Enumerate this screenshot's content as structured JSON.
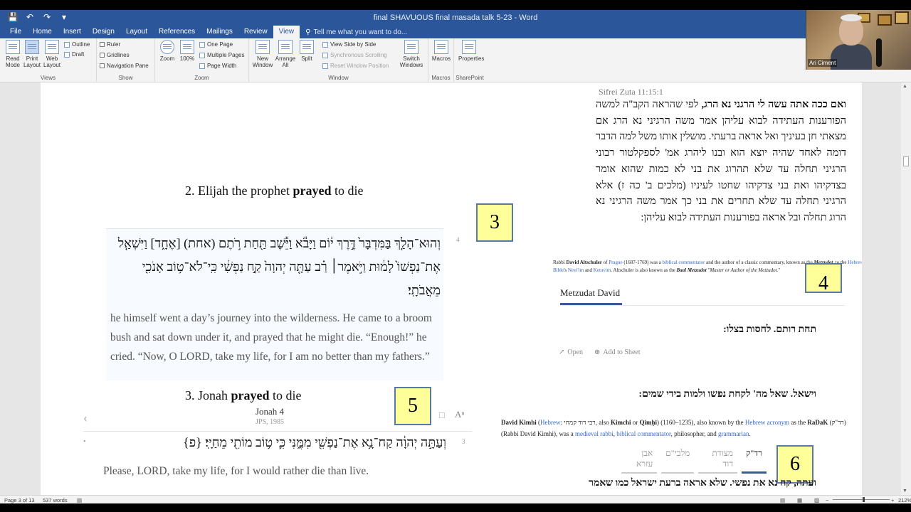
{
  "window": {
    "title": "final SHAVUOUS final masada talk 5-23 - Word"
  },
  "qat": {
    "save_icon": "save-icon",
    "undo_icon": "undo-icon",
    "redo_icon": "redo-icon",
    "customize_icon": "customize-qat-icon"
  },
  "tabs": [
    {
      "label": "File"
    },
    {
      "label": "Home"
    },
    {
      "label": "Insert"
    },
    {
      "label": "Design"
    },
    {
      "label": "Layout"
    },
    {
      "label": "References"
    },
    {
      "label": "Mailings"
    },
    {
      "label": "Review"
    },
    {
      "label": "View"
    }
  ],
  "active_tab": "View",
  "tellme": "Tell me what you want to do...",
  "ribbon": {
    "views": {
      "label": "Views",
      "read_mode": "Read Mode",
      "print_layout": "Print Layout",
      "web_layout": "Web Layout",
      "outline": "Outline",
      "draft": "Draft"
    },
    "show": {
      "label": "Show",
      "ruler": "Ruler",
      "gridlines": "Gridlines",
      "navigation_pane": "Navigation Pane"
    },
    "zoom": {
      "label": "Zoom",
      "zoom": "Zoom",
      "hundred": "100%",
      "one_page": "One Page",
      "multiple_pages": "Multiple Pages",
      "page_width": "Page Width"
    },
    "window": {
      "label": "Window",
      "new_window": "New Window",
      "arrange_all": "Arrange All",
      "split": "Split",
      "view_side_by_side": "View Side by Side",
      "synchronous_scrolling": "Synchronous Scrolling",
      "reset_window_position": "Reset Window Position",
      "switch_windows": "Switch Windows"
    },
    "macros": {
      "label": "Macros",
      "macros": "Macros"
    },
    "sharepoint": {
      "label": "SharePoint",
      "properties": "Properties"
    }
  },
  "webcam": {
    "name": "Ari Ciment"
  },
  "document": {
    "heading2": {
      "prefix": "2. Elijah the prophet ",
      "bold": "prayed",
      "suffix": " to die"
    },
    "box3": "3",
    "verse_num_1": "4",
    "hebrew1": "וְהוּא־הָלַ֤ךְ בַּמִּדְבָּר֙ דֶּ֣רֶךְ י֔וֹם וַיָּבֹ֕א וַיֵּ֕שֶׁב תַּ֖חַת רֹ֣תֶם (אחת) [אֶחָ֑ד] וַיִּשְׁאַ֤ל אֶת־נַפְשׁוֹ֙ לָמ֔וּת וַיֹּ֣אמֶר׀ רַ֗ב עַתָּ֤ה יְהוָה֙ קַ֣ח נַפְשִׁ֔י כִּֽי־לֹא־ט֥וֹב אָנֹכִ֖י מֵאֲבֹתָֽי׃",
    "english1": "he himself went a day’s journey into the wilderness. He came to a broom bush and sat down under it, and prayed that he might die. “Enough!” he cried. “Now, O LORD, take my life, for I am no better than my fathers.”",
    "heading3": {
      "prefix": "3. Jonah ",
      "bold": "prayed",
      "suffix": " to die"
    },
    "box5": "5",
    "source_title": "Jonah 4",
    "source_sub": "JPS, 1985",
    "verse_num_2": "3",
    "hebrew2": "וְעַתָּ֣ה יְהוָ֔ה קַח־נָ֥א אֶת־נַפְשִׁ֖י מִמֶּ֑נִּי כִּ֛י ט֥וֹב מוֹתִ֖י מֵחַיָּֽי׃ {פ}",
    "english2": "Please, LORD, take my life, for I would rather die than live.",
    "sifrei_ref": "Sifrei Zuta 11:15:1",
    "sifrei_bold": "ואם ככה אתה עשה לי הרגני נא הרג,",
    "sifrei_rest": " לפי שהראה הקב\"ה למשה הפורענות העתידה לבוא עליהן אמר משה הרגיני נא הרג אם מצאתי חן בעיניך ואל אראה ברעתי. מושלין אותו משל למה הדבר דומה לאחד שהיה יוצא הוא ובנו ליהרג אמ' לספקלטור רבוני הרגיני תחלה עד שלא תהרוג את בני לא כמות שהוא אומר בצדקיהו ואת בני צדקיהו שחטו לעיניו (מלכים ב' כה ז) אלא הרגיני תחלה עד שלא תחרים את בני כך אמר משה הרגיני נא הרוג תחלה ובל אראה בפורענות העתידה לבוא עליהן:",
    "wiki1": {
      "t1": "Rabbi ",
      "b1": "David Altschuler",
      "t2": " of ",
      "l1": "Prague",
      "t3": " (1687-1769) was a ",
      "l2": "biblical commentator",
      "t4": " and the author of a classic commentary, known as the ",
      "b2": "Metzudot",
      "t5": ", to the ",
      "l3": "Hebrew Bible",
      "t6": "'s ",
      "l4": "Nevi'im",
      "t7": " and ",
      "l5": "Ketuvim",
      "t8": ". Altschuler is also known as the ",
      "b3": "Baal Metzudot",
      "t9": " \"Master or Author of the Metzudot.\""
    },
    "box4": "4",
    "metzudat_title": "Metzudat David",
    "rashi1": "תחת רותם. לחסות בצלו:",
    "open_label": "Open",
    "add_sheet_label": "Add to Sheet",
    "rashi2": "וישאל. שאל מה' לקחת נפשו ולמות בידי שמים:",
    "wiki2": {
      "b1": "David Kimhi",
      "t1": " (",
      "l1": "Hebrew",
      "t2": ": רבי דוד קמחי, also ",
      "b2": "Kimchi",
      "t3": " or ",
      "b3": "Qimḥi",
      "t4": ") (1160–1235), also known by the ",
      "l2": "Hebrew acronym",
      "t5": " as the ",
      "b4": "RaDaK",
      "t6": " (רד\"ק) (Rabbi David Kimhi), was a ",
      "l3": "medieval rabbi",
      "t7": ", ",
      "l4": "biblical commentator",
      "t8": ", philosopher, and ",
      "l5": "grammarian",
      "t9": "."
    },
    "commentary_tabs": [
      "רד\"ק",
      "מצודת דוד",
      "מלבי\"ם",
      "אבן עזרא"
    ],
    "box6": "6",
    "radak": "ועתה, קח נא את נפשי. שלא אראה ברעת ישראל כמו שאמר"
  },
  "statusbar": {
    "page": "Page 3 of 13",
    "words": "537 words",
    "zoom": "212%"
  }
}
